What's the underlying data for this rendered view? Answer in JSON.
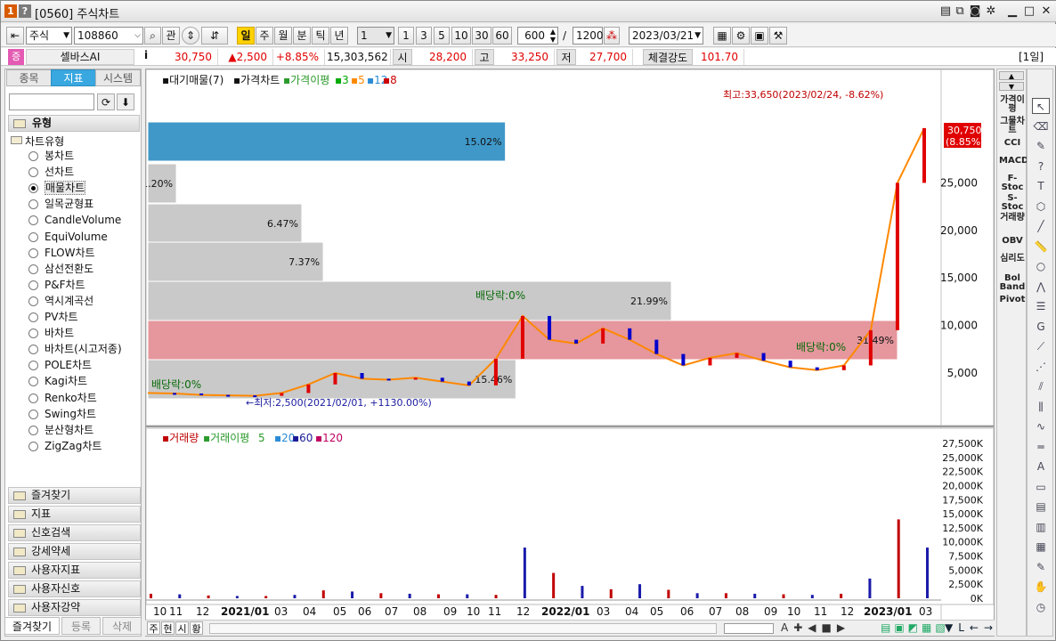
{
  "window": {
    "badge_left": "1",
    "badge_right": "?",
    "title": "[0560] 주식차트"
  },
  "toolbar": {
    "market": "주식",
    "code": "108860",
    "search_btn": "⌕",
    "watch_btn": "관",
    "periods": [
      "일",
      "주",
      "월",
      "분",
      "틱",
      "년"
    ],
    "selected_period": "일",
    "interval": "1",
    "quick_intervals": [
      "1",
      "3",
      "5",
      "10",
      "30",
      "60"
    ],
    "count": "600",
    "slash": "/",
    "total": "1200",
    "date": "2023/03/21"
  },
  "quote": {
    "badge": "증",
    "name": "셀바스AI",
    "info_btn": "i",
    "price": "30,750",
    "change": "▲2,500",
    "rate": "+8.85%",
    "volume": "15,303,562",
    "open_label": "시",
    "open": "28,200",
    "high_label": "고",
    "high": "33,250",
    "low_label": "저",
    "low": "27,700",
    "strength_label": "체결강도",
    "strength": "101.70",
    "period_label": "[1일]"
  },
  "left_panel": {
    "tabs": [
      "종목",
      "지표",
      "시스템"
    ],
    "selected_tab": "지표",
    "group_title": "유형",
    "subgroup": "차트유형",
    "chart_types": [
      "봉차트",
      "선차트",
      "매물차트",
      "일목균형표",
      "CandleVolume",
      "EquiVolume",
      "FLOW차트",
      "삼선전환도",
      "P&F차트",
      "역시계곡선",
      "PV차트",
      "바차트",
      "바차트(시고저종)",
      "POLE차트",
      "Kagi차트",
      "Renko차트",
      "Swing차트",
      "분산형차트",
      "ZigZag차트"
    ],
    "selected_type": "매물차트",
    "accordion": [
      "즐겨찾기",
      "지표",
      "신호검색",
      "강세약세",
      "사용자지표",
      "사용자신호",
      "사용자강약"
    ],
    "bottom_tabs": [
      "즐겨찾기",
      "등록",
      "삭제"
    ]
  },
  "right_indicators": [
    "가격이평",
    "그물차트",
    "CCI",
    "MACD",
    "F-Stoc",
    "S-Stoc",
    "거래량",
    "OBV",
    "심리도",
    "Bol Band",
    "Pivot"
  ],
  "draw_tools": [
    "cursor-icon",
    "eraser-icon",
    "paint-icon",
    "help-icon",
    "text-icon",
    "magnet-icon",
    "line-icon",
    "ruler-icon",
    "circle-icon",
    "zigzag-icon",
    "hlines-icon",
    "gann-icon",
    "fan-icon",
    "fib-icon",
    "speed-icon",
    "channel-icon",
    "wave-icon",
    "horiz-icon",
    "auto-icon",
    "panel-icon",
    "doc-icon",
    "bars-icon",
    "pnf-icon",
    "wrench-icon",
    "hand-icon",
    "timer-icon"
  ],
  "price_chart": {
    "legend": {
      "vp": "대기매물(7)",
      "price": "가격차트",
      "ma_label": "가격이평",
      "ma_periods": [
        "3",
        "5",
        "12",
        "8"
      ]
    },
    "high_note": "최고:33,650(2023/02/24, -8.62%)",
    "low_note": "←최저:2,500(2021/02/01, +1130.00%)",
    "div1": "배당락:0%",
    "div2": "배당락:0%",
    "div3": "배당락:0%",
    "current_price": "30,750",
    "current_rate": "(8.85%)",
    "colors": {
      "up": "#e00000",
      "down": "#0000cc",
      "ma3": "#00aa00",
      "ma5": "#ff8800",
      "ma12": "#2a8bd6",
      "ma8": "#cc0000"
    }
  },
  "volume_chart": {
    "legend": {
      "vol": "거래량",
      "ma_label": "거래이평",
      "ma_periods": [
        "5",
        "20",
        "60",
        "120"
      ]
    }
  },
  "chart_data": [
    {
      "type": "bar",
      "title": "대기매물(7)",
      "orientation": "horizontal",
      "categories": [
        "27500-32000",
        "25000-27500",
        "21000-25000",
        "17000-21000",
        "12800-17000",
        "8900-12800",
        "5000-8900"
      ],
      "values": [
        15.02,
        1.2,
        6.47,
        7.37,
        21.99,
        31.49,
        15.46
      ],
      "labels": [
        "15.02%",
        "1.20%",
        "6.47%",
        "7.37%",
        "21.99%",
        "31.49%",
        "15.46%"
      ],
      "highlight_band": "8900-12800"
    },
    {
      "type": "line",
      "title": "가격차트",
      "x": [
        "2020-10",
        "2020-11",
        "2020-12",
        "2021-01",
        "2021-02",
        "2021-03",
        "2021-04",
        "2021-05",
        "2021-06",
        "2021-07",
        "2021-08",
        "2021-09",
        "2021-10",
        "2021-11",
        "2021-12",
        "2022-01",
        "2022-02",
        "2022-03",
        "2022-04",
        "2022-05",
        "2022-06",
        "2022-07",
        "2022-08",
        "2022-09",
        "2022-10",
        "2022-11",
        "2022-12",
        "2023-01",
        "2023-02",
        "2023-03"
      ],
      "values": [
        2900,
        2850,
        2700,
        2650,
        2600,
        2900,
        3800,
        5000,
        4400,
        4300,
        4500,
        4100,
        3700,
        6500,
        11000,
        8500,
        8100,
        9700,
        8500,
        7000,
        5800,
        6600,
        7100,
        6300,
        5600,
        5300,
        5800,
        9500,
        25000,
        30750
      ],
      "y_ticks": [
        "5,000",
        "10,000",
        "15,000",
        "20,000",
        "25,000"
      ],
      "ylim": [
        2500,
        33650
      ]
    },
    {
      "type": "bar",
      "title": "거래량",
      "x_ticks": [
        "10",
        "11",
        "12",
        "2021/01",
        "03",
        "04",
        "05",
        "06",
        "07",
        "08",
        "09",
        "10",
        "11",
        "12",
        "2022/01",
        "03",
        "04",
        "05",
        "06",
        "07",
        "08",
        "09",
        "10",
        "11",
        "12",
        "2023/01",
        "03"
      ],
      "values_k": [
        800,
        700,
        500,
        400,
        400,
        600,
        1400,
        1200,
        900,
        800,
        700,
        700,
        600,
        9000,
        4500,
        2200,
        1600,
        2500,
        1500,
        900,
        900,
        800,
        700,
        600,
        800,
        3500,
        14000,
        9000
      ],
      "y_ticks": [
        "0K",
        "2,500K",
        "5,000K",
        "7,500K",
        "10,000K",
        "12,500K",
        "15,000K",
        "17,500K",
        "20,000K",
        "22,500K",
        "25,000K",
        "27,500K"
      ],
      "ylim": [
        0,
        27500
      ]
    }
  ],
  "bottom_tabs": [
    "주",
    "현",
    "시",
    "황"
  ]
}
